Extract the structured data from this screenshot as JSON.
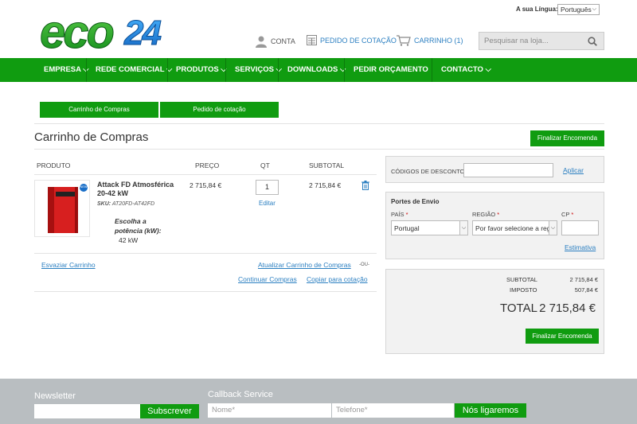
{
  "logo": {
    "text": "eco24"
  },
  "lang": {
    "label": "A sua Língua:",
    "value": "Português"
  },
  "header": {
    "account": "CONTA",
    "quote": "PEDIDO DE COTAÇÃO",
    "cart": "CARRINHO (1)",
    "search_placeholder": "Pesquisar na loja..."
  },
  "nav": [
    "EMPRESA",
    "REDE COMERCIAL",
    "PRODUTOS",
    "SERVIÇOS",
    "DOWNLOADS",
    "PEDIR ORÇAMENTO",
    "CONTACTO"
  ],
  "tabs": [
    "Carrinho de Compras",
    "Pedido de cotação"
  ],
  "page": {
    "title": "Carrinho de Compras",
    "checkout": "Finalizar Encomenda"
  },
  "table": {
    "headers": [
      "PRODUTO",
      "PREÇO",
      "QT",
      "SUBTOTAL"
    ],
    "item": {
      "name": "Attack FD Atmosférica 20-42 kW",
      "sku_label": "SKU:",
      "sku": "AT20FD-AT42FD",
      "option_label": "Escolha a potência (kW):",
      "option_value": "42 kW",
      "price": "2 715,84 €",
      "qty": "1",
      "edit": "Editar",
      "subtotal": "2 715,84 €",
      "badge": "NEW"
    }
  },
  "actions": {
    "empty": "Esvaziar Carrinho",
    "update": "Atualizar Carrinho de Compras",
    "or": "-OU-",
    "continue": "Continuar Compras",
    "copy": "Copiar para cotação"
  },
  "discount": {
    "label": "CÓDIGOS DE DESCONTO",
    "apply": "Aplicar"
  },
  "shipping": {
    "title": "Portes de Envio",
    "country_label": "PAÍS",
    "country": "Portugal",
    "region_label": "REGIÃO",
    "region": "Por favor selecione a região",
    "zip_label": "CP",
    "estimate": "Estimativa"
  },
  "totals": {
    "subtotal_label": "SUBTOTAL",
    "subtotal": "2 715,84 €",
    "tax_label": "IMPOSTO",
    "tax": "507,84 €",
    "total_label": "TOTAL",
    "total": "2 715,84 €",
    "checkout": "Finalizar Encomenda"
  },
  "footer": {
    "newsletter": "Newsletter",
    "subscribe": "Subscrever",
    "callback": "Callback Service",
    "name_ph": "Nome*",
    "phone_ph": "Telefone*",
    "call": "Nós ligaremos"
  },
  "colors": {
    "green": "#109c10",
    "blue": "#2b7fc1",
    "logo_green": "#2aa12a",
    "logo_blue": "#1a7fd0"
  }
}
